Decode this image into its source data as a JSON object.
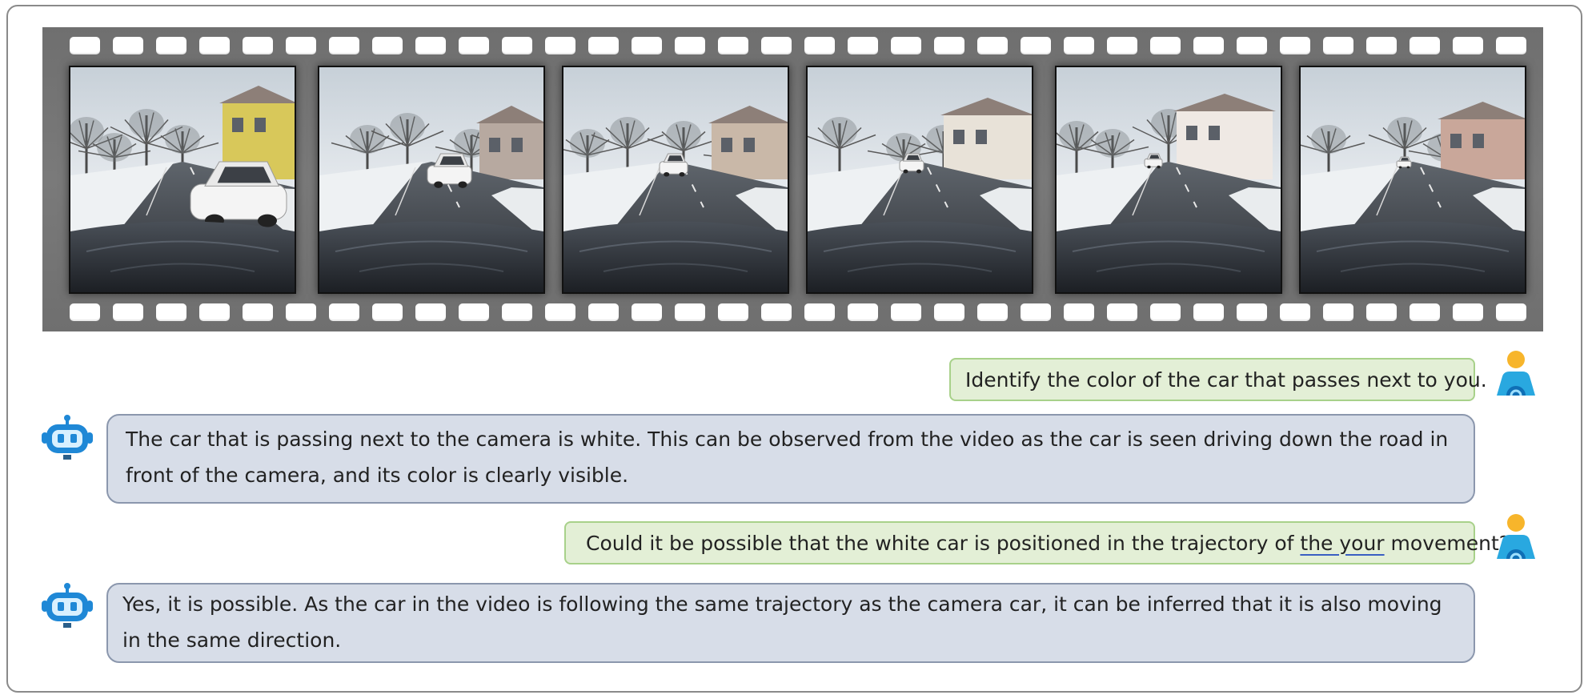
{
  "conversation": {
    "q1": "Identify the color of the car that passes next to you.",
    "a1": "The car that is passing next to the camera is white. This can be observed from the video as the car is seen driving down the road in front of the camera, and its color is clearly visible.",
    "q2_before": "Could it be possible that the white car is positioned in the trajectory of ",
    "q2_underlined": "the your",
    "q2_after": " movement?",
    "a2": "Yes, it is possible. As the car in the video is following the same trajectory as the camera car, it can be inferred that it is also moving in the same direction."
  },
  "icons": {
    "user": "user-avatar-icon",
    "bot": "robot-avatar-icon"
  },
  "colors": {
    "user_bubble_bg": "#e3efd6",
    "user_bubble_border": "#a8d18a",
    "bot_bubble_bg": "#d7dde8",
    "bot_bubble_border": "#8b97ad",
    "robot_blue": "#1f88d6",
    "user_head": "#f7b52b",
    "user_body": "#29a8e0",
    "film_gray": "#757575"
  },
  "filmstrip": {
    "frame_count": 6,
    "sprocket_count": 34
  }
}
